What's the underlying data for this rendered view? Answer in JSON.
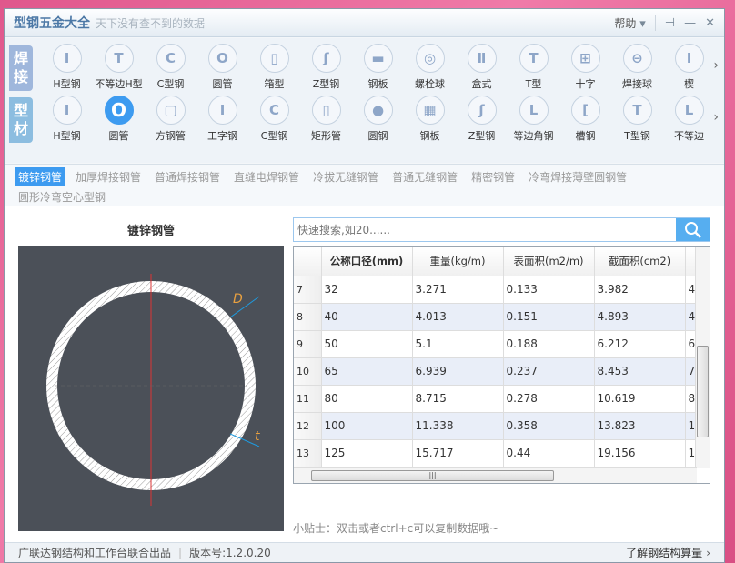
{
  "title": {
    "app": "型钢五金大全",
    "slogan": "天下没有查不到的数据",
    "help": "帮助",
    "help_arrow": "▾",
    "pin": "⊣",
    "minimize": "—",
    "close": "✕"
  },
  "categories": [
    {
      "label": [
        "焊",
        "接"
      ],
      "color": "#9fb7dc",
      "items": [
        {
          "label": "H型钢",
          "glyph": "I"
        },
        {
          "label": "不等边H型",
          "glyph": "T"
        },
        {
          "label": "C型钢",
          "glyph": "C"
        },
        {
          "label": "圆管",
          "glyph": "O"
        },
        {
          "label": "箱型",
          "glyph": "▯"
        },
        {
          "label": "Z型钢",
          "glyph": "ʃ"
        },
        {
          "label": "钢板",
          "glyph": "▬"
        },
        {
          "label": "螺栓球",
          "glyph": "◎"
        },
        {
          "label": "盒式",
          "glyph": "Ⅱ"
        },
        {
          "label": "T型",
          "glyph": "T"
        },
        {
          "label": "十字",
          "glyph": "⊞"
        },
        {
          "label": "焊接球",
          "glyph": "⊖"
        },
        {
          "label": "楔",
          "glyph": "I"
        }
      ]
    },
    {
      "label": [
        "型",
        "材"
      ],
      "color": "#8cbde0",
      "items": [
        {
          "label": "H型钢",
          "glyph": "I"
        },
        {
          "label": "圆管",
          "glyph": "O",
          "selected": true
        },
        {
          "label": "方钢管",
          "glyph": "▢"
        },
        {
          "label": "工字钢",
          "glyph": "I"
        },
        {
          "label": "C型钢",
          "glyph": "C"
        },
        {
          "label": "矩形管",
          "glyph": "▯"
        },
        {
          "label": "圆钢",
          "glyph": "●"
        },
        {
          "label": "钢板",
          "glyph": "▦"
        },
        {
          "label": "Z型钢",
          "glyph": "ʃ"
        },
        {
          "label": "等边角钢",
          "glyph": "L"
        },
        {
          "label": "槽钢",
          "glyph": "["
        },
        {
          "label": "T型钢",
          "glyph": "T"
        },
        {
          "label": "不等边",
          "glyph": "L"
        }
      ]
    }
  ],
  "more_arrow": "›",
  "subtabs": [
    "镀锌钢管",
    "加厚焊接钢管",
    "普通焊接钢管",
    "直缝电焊钢管",
    "冷拔无缝钢管",
    "普通无缝钢管",
    "精密钢管",
    "冷弯焊接薄壁圆钢管",
    "圆形冷弯空心型钢"
  ],
  "preview": {
    "title": "镀锌钢管",
    "dim_d": "D",
    "dim_t": "t"
  },
  "search": {
    "placeholder": "快速搜索,如20......"
  },
  "table": {
    "headers": [
      "公称口径(mm)",
      "重量(kg/m)",
      "表面积(m2/m)",
      "截面积(cm2)",
      ""
    ],
    "rows": [
      [
        "7",
        "32",
        "3.271",
        "0.133",
        "3.982",
        "4"
      ],
      [
        "8",
        "40",
        "4.013",
        "0.151",
        "4.893",
        "4"
      ],
      [
        "9",
        "50",
        "5.1",
        "0.188",
        "6.212",
        "6"
      ],
      [
        "10",
        "65",
        "6.939",
        "0.237",
        "8.453",
        "7"
      ],
      [
        "11",
        "80",
        "8.715",
        "0.278",
        "10.619",
        "8"
      ],
      [
        "12",
        "100",
        "11.338",
        "0.358",
        "13.823",
        "1"
      ],
      [
        "13",
        "125",
        "15.717",
        "0.44",
        "19.156",
        "1"
      ]
    ]
  },
  "tip": "小贴士：双击或者ctrl+c可以复制数据哦~",
  "status": {
    "credit": "广联达钢结构和工作台联合出品",
    "version": "版本号:1.2.0.20",
    "learn": "了解钢结构算量"
  },
  "colors": {
    "accent": "#3d9bf0",
    "preview_bg": "#4b5058"
  }
}
